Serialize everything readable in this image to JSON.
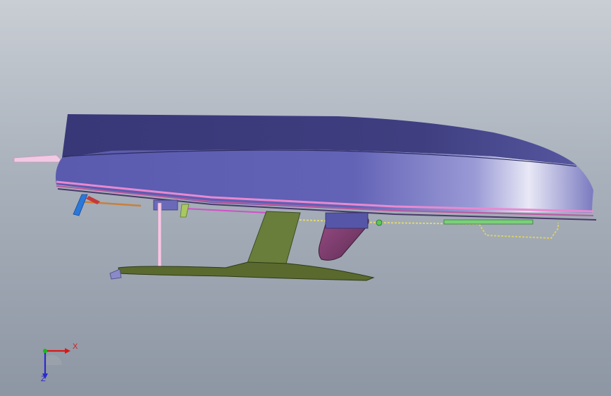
{
  "viewport": {
    "background_top": "#c9ced4",
    "background_bottom": "#8d96a3"
  },
  "model": {
    "hull_color": "#5e5fb3",
    "hull_top_color": "#3d3d7e",
    "keel_color": "#667a3a",
    "rudder_color": "#7a3c6c",
    "trim_line_color": "#e88ad0",
    "rigging_color": "#d8d066"
  },
  "triad": {
    "x_label": "X",
    "z_label": "Z",
    "x_color": "#d81818",
    "y_color": "#18b818",
    "z_color": "#2a2ad0"
  }
}
